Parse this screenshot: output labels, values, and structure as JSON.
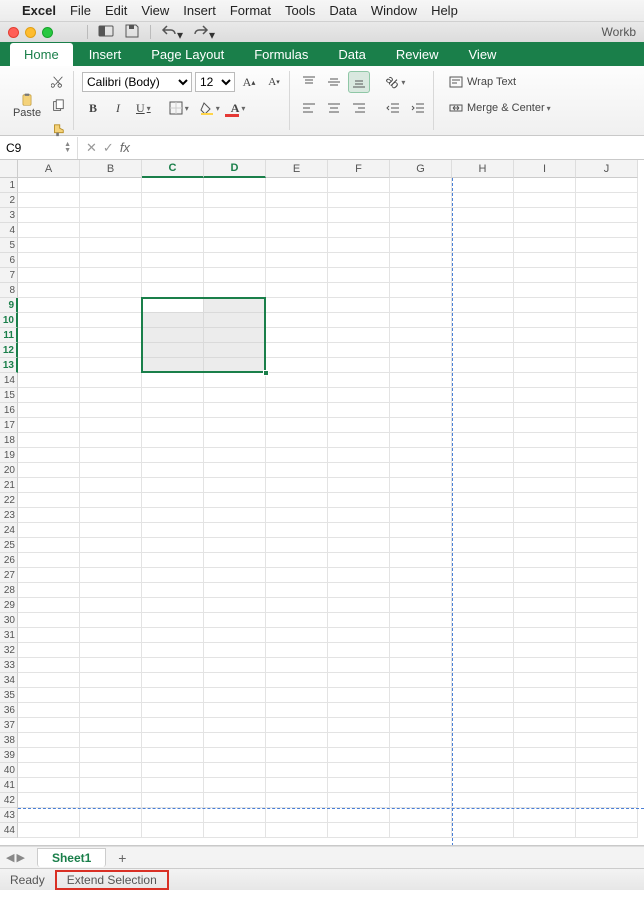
{
  "mac_menu": {
    "app": "Excel",
    "items": [
      "File",
      "Edit",
      "View",
      "Insert",
      "Format",
      "Tools",
      "Data",
      "Window",
      "Help"
    ]
  },
  "title_right": "Workb",
  "ribbon_tabs": [
    "Home",
    "Insert",
    "Page Layout",
    "Formulas",
    "Data",
    "Review",
    "View"
  ],
  "active_tab": "Home",
  "clipboard": {
    "paste": "Paste"
  },
  "font": {
    "name": "Calibri (Body)",
    "size": "12"
  },
  "alignment": {
    "wrap": "Wrap Text",
    "merge": "Merge & Center"
  },
  "name_box": "C9",
  "fx_label": "fx",
  "columns": [
    "A",
    "B",
    "C",
    "D",
    "E",
    "F",
    "G",
    "H",
    "I",
    "J"
  ],
  "sel_cols": [
    "C",
    "D"
  ],
  "row_count": 44,
  "sel_rows": [
    9,
    10,
    11,
    12,
    13
  ],
  "selection": {
    "top_row": 9,
    "left_col": 3,
    "rows": 5,
    "cols": 2
  },
  "page_break_col_after": 7,
  "page_break_row_after": 42,
  "sheet_tab": "Sheet1",
  "status": {
    "ready": "Ready",
    "extend": "Extend Selection"
  }
}
